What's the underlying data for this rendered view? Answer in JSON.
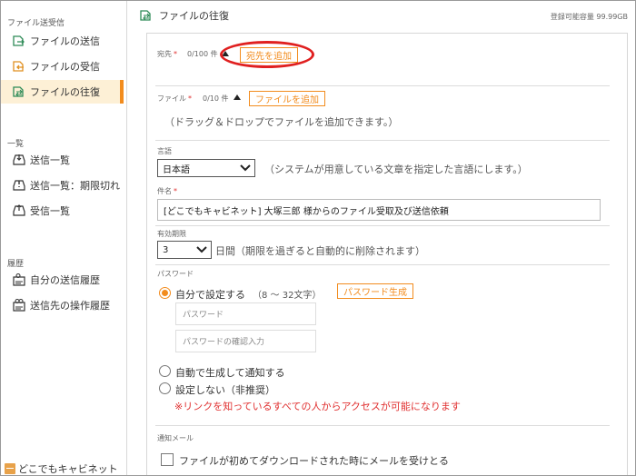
{
  "sidebar": {
    "sections": [
      {
        "title": "ファイル送受信",
        "items": [
          {
            "label": "ファイルの送信",
            "icon": "file-send-icon"
          },
          {
            "label": "ファイルの受信",
            "icon": "file-receive-icon"
          },
          {
            "label": "ファイルの往復",
            "icon": "file-roundtrip-icon",
            "active": true
          }
        ]
      },
      {
        "title": "一覧",
        "items": [
          {
            "label": "送信一覧",
            "icon": "inbox-send-icon"
          },
          {
            "label": "送信一覧：期限切れ",
            "icon": "inbox-expired-icon"
          },
          {
            "label": "受信一覧",
            "icon": "inbox-receive-icon"
          }
        ]
      },
      {
        "title": "履歴",
        "items": [
          {
            "label": "自分の送信履歴",
            "icon": "user-history-icon"
          },
          {
            "label": "送信先の操作履歴",
            "icon": "recipient-history-icon"
          }
        ]
      }
    ],
    "footer": "どこでもキャビネット"
  },
  "header": {
    "title": "ファイルの往復",
    "capacity": "登録可能容量 99.99GB"
  },
  "form": {
    "recipient": {
      "label": "宛先",
      "required": "*",
      "count": "0/100 件",
      "add_button": "宛先を追加"
    },
    "file": {
      "label": "ファイル",
      "required": "*",
      "count": "0/10 件",
      "add_button": "ファイルを追加",
      "drop_hint": "（ドラッグ＆ドロップでファイルを追加できます。）"
    },
    "language": {
      "label": "言語",
      "selected": "日本語",
      "hint": "（システムが用意している文章を指定した言語にします。）"
    },
    "subject": {
      "label": "件名",
      "required": "*",
      "value": "[どこでもキャビネット] 大塚三郎 様からのファイル受取及び送信依頼"
    },
    "expiry": {
      "label": "有効期限",
      "selected": "3",
      "unit": "日間",
      "hint": "（期限を過ぎると自動的に削除されます）"
    },
    "password": {
      "label": "パスワード",
      "option_self": "自分で設定する",
      "option_self_note": "（8 〜 32文字）",
      "generate_button": "パスワード生成",
      "password_placeholder": "パスワード",
      "confirm_placeholder": "パスワードの確認入力",
      "option_auto": "自動で生成して通知する",
      "option_none": "設定しない（非推奨）",
      "warning": "※リンクを知っているすべての人からアクセスが可能になります"
    },
    "notify": {
      "label": "通知メール",
      "checkbox_label": "ファイルが初めてダウンロードされた時にメールを受けとる"
    }
  },
  "colors": {
    "accent": "#f28c1e",
    "highlight": "#e02020",
    "active_bg": "#fdf0d6",
    "icon_green": "#2e8b57"
  }
}
